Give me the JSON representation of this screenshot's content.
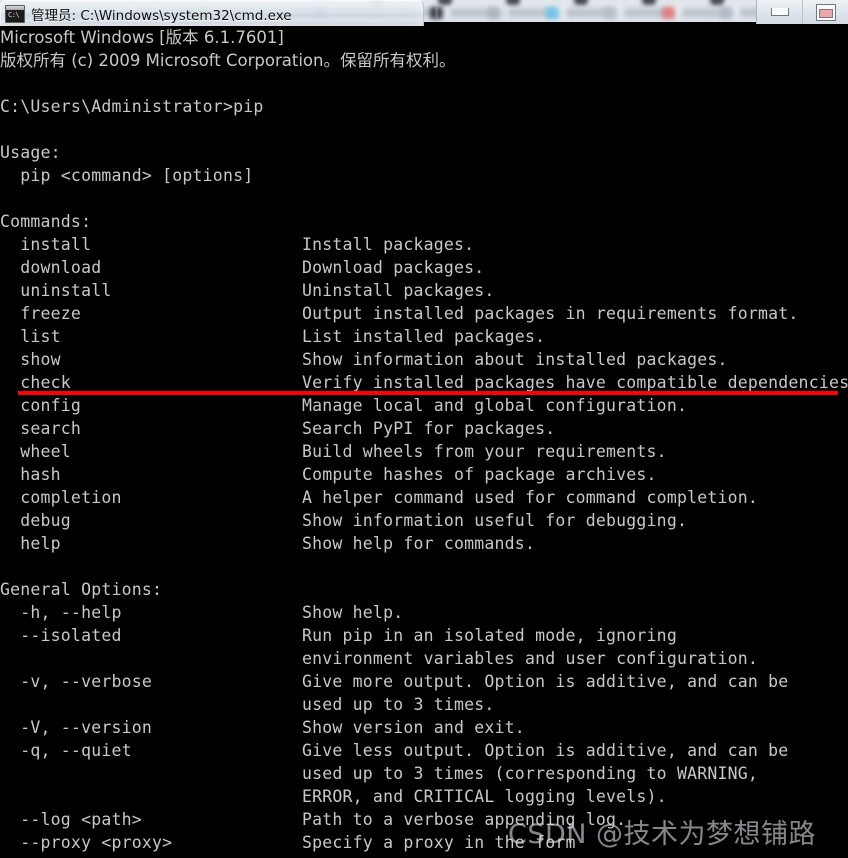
{
  "window": {
    "title": "管理员: C:\\Windows\\system32\\cmd.exe",
    "icon_prompt": "C:\\",
    "minimize_label": "最小化",
    "maximize_label": "最大化"
  },
  "background": {
    "tabs": [
      "",
      "",
      "",
      "",
      "",
      "",
      "",
      ""
    ],
    "tab_colors": [
      "#b9c4ce",
      "#a9e39a",
      "#b6bfc8",
      "#4f8fd6",
      "#b0bac4",
      "#2e3338",
      "#aab4be",
      "#6fc4e8",
      "#b4bec8",
      "#e07a7a",
      "#b0bac4",
      "#6aa9dd"
    ]
  },
  "terminal": {
    "colors": {
      "background": "#000000",
      "foreground": "#c8c8c8",
      "annotation": "#ff0000"
    },
    "lines": [
      {
        "left": "Microsoft Windows [版本 6.1.7601]",
        "right": "",
        "cjk": true
      },
      {
        "left": "版权所有 (c) 2009 Microsoft Corporation。保留所有权利。",
        "right": "",
        "cjk": true
      },
      {
        "left": "",
        "right": ""
      },
      {
        "left": "C:\\Users\\Administrator>pip",
        "right": ""
      },
      {
        "left": "",
        "right": ""
      },
      {
        "left": "Usage:",
        "right": ""
      },
      {
        "left": "  pip <command> [options]",
        "right": ""
      },
      {
        "left": "",
        "right": ""
      },
      {
        "left": "Commands:",
        "right": ""
      },
      {
        "left": "  install",
        "right": "Install packages."
      },
      {
        "left": "  download",
        "right": "Download packages."
      },
      {
        "left": "  uninstall",
        "right": "Uninstall packages."
      },
      {
        "left": "  freeze",
        "right": "Output installed packages in requirements format."
      },
      {
        "left": "  list",
        "right": "List installed packages."
      },
      {
        "left": "  show",
        "right": "Show information about installed packages."
      },
      {
        "left": "  check",
        "right": "Verify installed packages have compatible dependencies."
      },
      {
        "left": "  config",
        "right": "Manage local and global configuration."
      },
      {
        "left": "  search",
        "right": "Search PyPI for packages."
      },
      {
        "left": "  wheel",
        "right": "Build wheels from your requirements."
      },
      {
        "left": "  hash",
        "right": "Compute hashes of package archives."
      },
      {
        "left": "  completion",
        "right": "A helper command used for command completion."
      },
      {
        "left": "  debug",
        "right": "Show information useful for debugging."
      },
      {
        "left": "  help",
        "right": "Show help for commands."
      },
      {
        "left": "",
        "right": ""
      },
      {
        "left": "General Options:",
        "right": ""
      },
      {
        "left": "  -h, --help",
        "right": "Show help."
      },
      {
        "left": "  --isolated",
        "right": "Run pip in an isolated mode, ignoring"
      },
      {
        "left": "",
        "right": "environment variables and user configuration."
      },
      {
        "left": "  -v, --verbose",
        "right": "Give more output. Option is additive, and can be"
      },
      {
        "left": "",
        "right": "used up to 3 times."
      },
      {
        "left": "  -V, --version",
        "right": "Show version and exit."
      },
      {
        "left": "  -q, --quiet",
        "right": "Give less output. Option is additive, and can be"
      },
      {
        "left": "",
        "right": "used up to 3 times (corresponding to WARNING,"
      },
      {
        "left": "",
        "right": "ERROR, and CRITICAL logging levels)."
      },
      {
        "left": "  --log <path>",
        "right": "Path to a verbose appending log."
      },
      {
        "left": "  --proxy <proxy>",
        "right": "Specify a proxy in the form"
      }
    ]
  },
  "annotation": {
    "red_underline_row": 15,
    "color": "#ff0000"
  },
  "watermark": {
    "text": "CSDN @技术为梦想铺路"
  }
}
